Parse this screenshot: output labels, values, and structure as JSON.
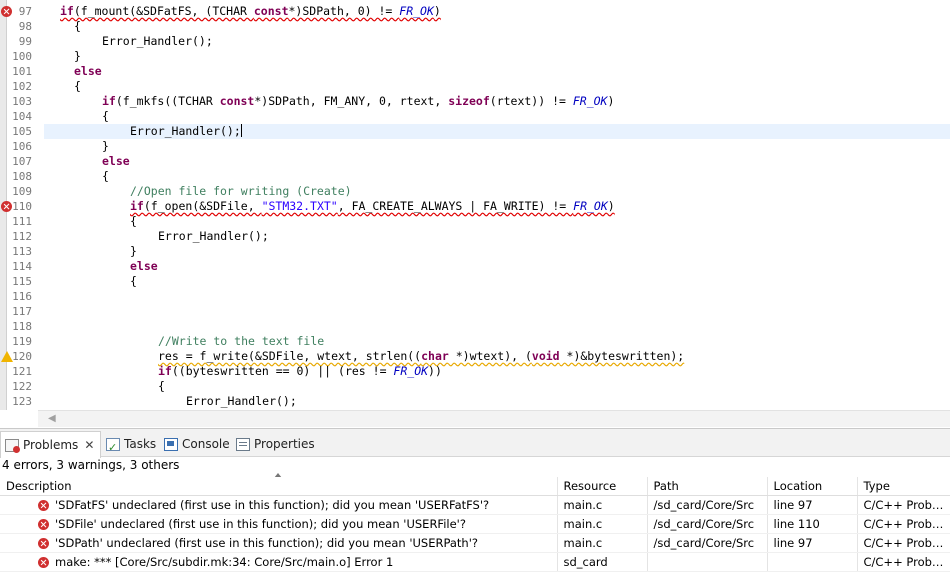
{
  "editor": {
    "lines": [
      {
        "n": "97",
        "marker": "error"
      },
      {
        "n": "98"
      },
      {
        "n": "99"
      },
      {
        "n": "100"
      },
      {
        "n": "101"
      },
      {
        "n": "102"
      },
      {
        "n": "103"
      },
      {
        "n": "104"
      },
      {
        "n": "105",
        "current": true
      },
      {
        "n": "106"
      },
      {
        "n": "107"
      },
      {
        "n": "108"
      },
      {
        "n": "109"
      },
      {
        "n": "110",
        "marker": "error"
      },
      {
        "n": "111"
      },
      {
        "n": "112"
      },
      {
        "n": "113"
      },
      {
        "n": "114"
      },
      {
        "n": "115"
      },
      {
        "n": "116"
      },
      {
        "n": "117"
      },
      {
        "n": "118"
      },
      {
        "n": "119"
      },
      {
        "n": "120",
        "marker": "warning"
      },
      {
        "n": "121"
      },
      {
        "n": "122"
      },
      {
        "n": "123"
      }
    ],
    "code": {
      "l97_if": "if",
      "l97_a": "(f_mount(&SDFatFS, (TCHAR ",
      "l97_const": "const",
      "l97_b": "*)SDPath, 0) != ",
      "l97_frok": "FR_OK",
      "l97_c": ")",
      "l98": "{",
      "l99": "Error_Handler();",
      "l100": "}",
      "l101_else": "else",
      "l102": "{",
      "l103_if": "if",
      "l103_a": "(f_mkfs((TCHAR ",
      "l103_const": "const",
      "l103_b": "*)SDPath, FM_ANY, 0, rtext, ",
      "l103_sizeof": "sizeof",
      "l103_c": "(rtext)) != ",
      "l103_frok": "FR_OK",
      "l103_d": ")",
      "l104": "{",
      "l105": "Error_Handler();",
      "l106": "}",
      "l107_else": "else",
      "l108": "{",
      "l109_comment": "//Open file for writing (Create)",
      "l110_if": "if",
      "l110_a": "(f_open(&SDFile, ",
      "l110_str": "\"STM32.TXT\"",
      "l110_b": ", FA_CREATE_ALWAYS | FA_WRITE) != ",
      "l110_frok": "FR_OK",
      "l110_c": ")",
      "l111": "{",
      "l112": "Error_Handler();",
      "l113": "}",
      "l114_else": "else",
      "l115": "{",
      "l119_comment": "//Write to the text file",
      "l120_a": "res = f_write(&SDFile, wtext, strlen((",
      "l120_char": "char",
      "l120_b": " *)wtext), (",
      "l120_void": "void",
      "l120_c": " *)&byteswritten);",
      "l121_if": "if",
      "l121_a": "((byteswritten == 0) || (res != ",
      "l121_frok": "FR_OK",
      "l121_b": "))",
      "l122": "{",
      "l123": "Error_Handler();"
    }
  },
  "views": {
    "tabs": [
      {
        "label": "Problems",
        "icon": "problems-icon",
        "active": true
      },
      {
        "label": "Tasks",
        "icon": "tasks-icon"
      },
      {
        "label": "Console",
        "icon": "console-icon"
      },
      {
        "label": "Properties",
        "icon": "properties-icon"
      }
    ],
    "close_glyph": "✕"
  },
  "problems": {
    "summary": "4 errors, 3 warnings, 3 others",
    "columns": [
      "Description",
      "Resource",
      "Path",
      "Location",
      "Type"
    ],
    "rows": [
      {
        "desc": "'SDFatFS' undeclared (first use in this function); did you mean 'USERFatFS'?",
        "resource": "main.c",
        "path": "/sd_card/Core/Src",
        "location": "line 97",
        "type": "C/C++ Probl..."
      },
      {
        "desc": "'SDFile' undeclared (first use in this function); did you mean 'USERFile'?",
        "resource": "main.c",
        "path": "/sd_card/Core/Src",
        "location": "line 110",
        "type": "C/C++ Probl..."
      },
      {
        "desc": "'SDPath' undeclared (first use in this function); did you mean 'USERPath'?",
        "resource": "main.c",
        "path": "/sd_card/Core/Src",
        "location": "line 97",
        "type": "C/C++ Probl..."
      },
      {
        "desc": "make: *** [Core/Src/subdir.mk:34: Core/Src/main.o] Error 1",
        "resource": "sd_card",
        "path": "",
        "location": "",
        "type": "C/C++ Probl..."
      }
    ]
  },
  "colors": {
    "error": "#d03030",
    "warning": "#f0b400",
    "keyword": "#7f0055",
    "comment": "#3f7f5f",
    "string": "#2a00ff",
    "macro": "#0000c0",
    "current_line": "#e8f2fe"
  }
}
